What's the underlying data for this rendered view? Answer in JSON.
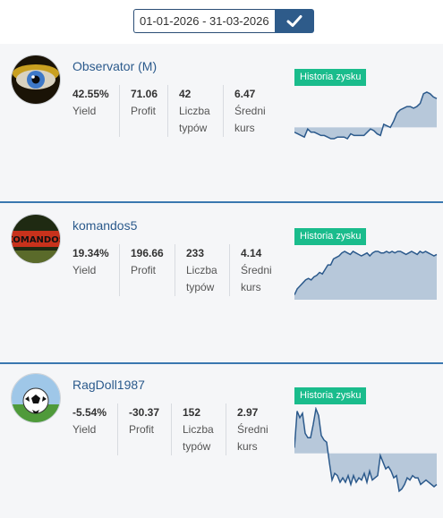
{
  "date_range": {
    "value": "01-01-2026 - 31-03-2026"
  },
  "tipsters": [
    {
      "name": "Observator (M)",
      "yield": "42.55%",
      "yield_label": "Yield",
      "profit": "71.06",
      "profit_label": "Profit",
      "types": "42",
      "types_label": "Liczba\ntypów",
      "avg": "6.47",
      "avg_label": "Średni\nkurs",
      "history_label": "Historia zysku",
      "history": [
        -3,
        -4,
        -5,
        -6,
        -1,
        -3,
        -3,
        -4,
        -5,
        -5,
        -6,
        -7,
        -7,
        -6,
        -6,
        -6,
        -7,
        -4,
        -5,
        -5,
        -5,
        -5,
        -3,
        -1,
        -2,
        -4,
        -5,
        2,
        1,
        0,
        4,
        9,
        11,
        12,
        13,
        13,
        12,
        13,
        15,
        21,
        22,
        21,
        19,
        18
      ]
    },
    {
      "name": "komandos5",
      "yield": "19.34%",
      "yield_label": "Yield",
      "profit": "196.66",
      "profit_label": "Profit",
      "types": "233",
      "types_label": "Liczba\ntypów",
      "avg": "4.14",
      "avg_label": "Średni\nkurs",
      "history_label": "Historia zysku",
      "history": [
        2,
        6,
        8,
        10,
        12,
        13,
        12,
        14,
        15,
        17,
        16,
        19,
        22,
        22,
        26,
        27,
        28,
        30,
        31,
        30,
        29,
        31,
        30,
        29,
        28,
        29,
        30,
        28,
        30,
        31,
        31,
        30,
        30,
        31,
        30,
        31,
        30,
        31,
        31,
        30,
        29,
        30,
        31,
        30,
        29,
        31,
        30,
        31,
        30,
        29,
        28,
        29
      ]
    },
    {
      "name": "RagDoll1987",
      "yield": "-5.54%",
      "yield_label": "Yield",
      "profit": "-30.37",
      "profit_label": "Profit",
      "types": "152",
      "types_label": "Liczba\ntypów",
      "avg": "2.97",
      "avg_label": "Średni\nkurs",
      "history_label": "Historia zysku",
      "history": [
        5,
        38,
        32,
        36,
        18,
        14,
        14,
        26,
        40,
        34,
        16,
        12,
        10,
        -8,
        -24,
        -18,
        -20,
        -26,
        -22,
        -26,
        -20,
        -28,
        -20,
        -26,
        -22,
        -24,
        -18,
        -26,
        -16,
        -24,
        -22,
        -20,
        -2,
        -8,
        -14,
        -12,
        -16,
        -22,
        -20,
        -34,
        -32,
        -28,
        -22,
        -24,
        -20,
        -22,
        -22,
        -28,
        -26,
        -24,
        -26,
        -28,
        -30,
        -28
      ]
    }
  ]
}
